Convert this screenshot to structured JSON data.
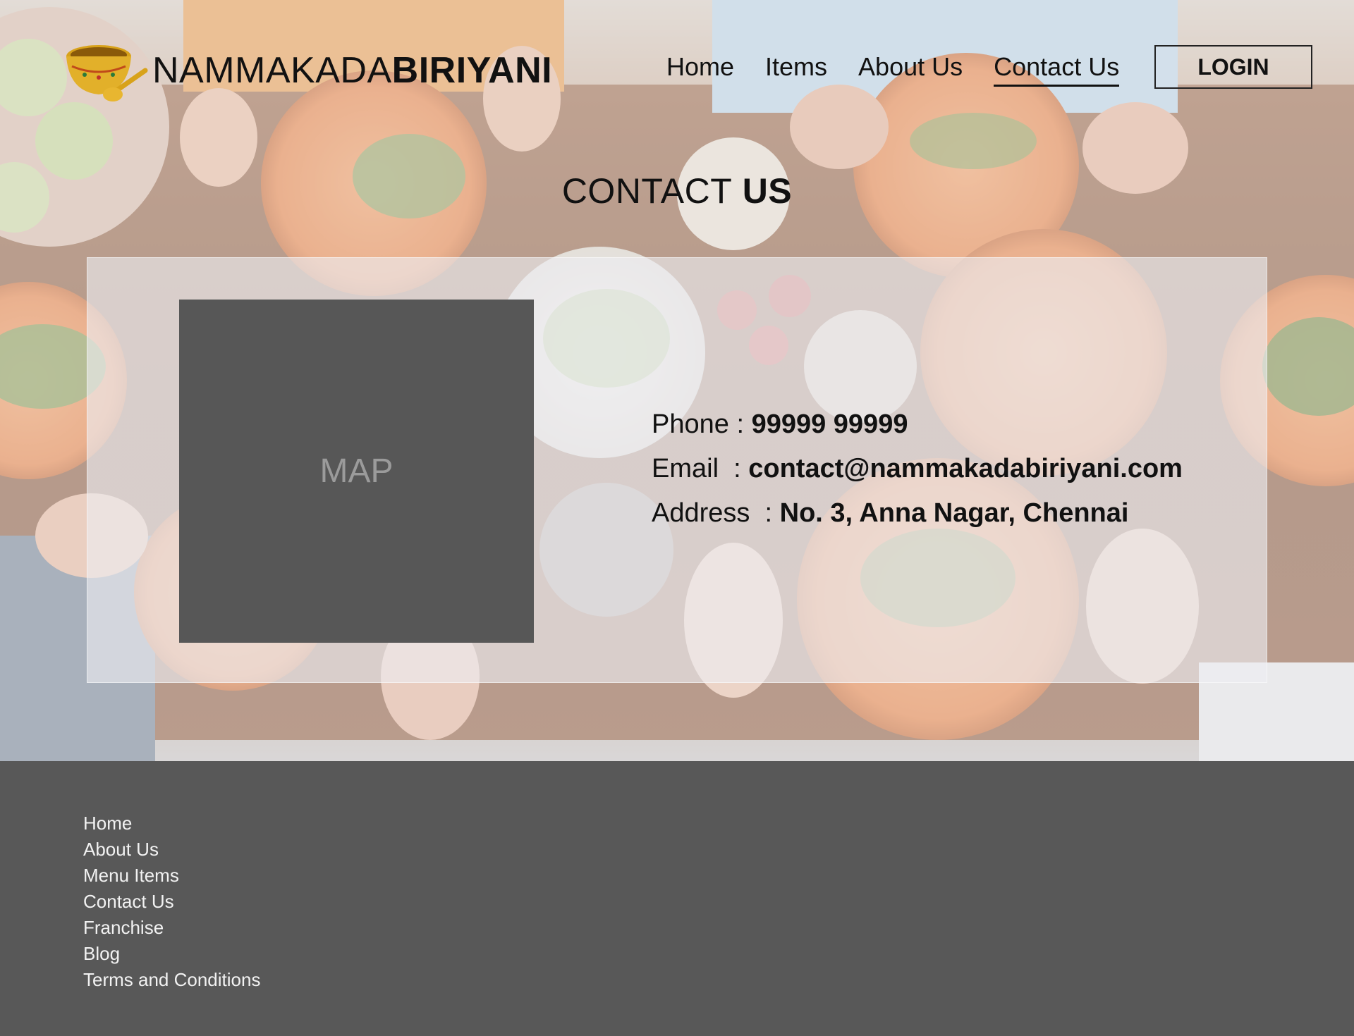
{
  "brand": {
    "name_light": "NAMMAKADA",
    "name_bold": "BIRIYANI",
    "logo_icon": "golden-bowl-with-spoon-icon"
  },
  "nav": {
    "links": [
      {
        "label": "Home",
        "active": false
      },
      {
        "label": "Items",
        "active": false
      },
      {
        "label": "About Us",
        "active": false
      },
      {
        "label": "Contact Us",
        "active": true
      }
    ],
    "login_label": "LOGIN"
  },
  "page_title": {
    "light": "CONTACT",
    "bold": "US"
  },
  "contact": {
    "map_placeholder": "MAP",
    "phone_label": "Phone : ",
    "phone_value": "99999 99999",
    "email_label": "Email  : ",
    "email_value": "contact@nammakadabiriyani.com",
    "address_label": "Address  : ",
    "address_value": "No. 3, Anna Nagar, Chennai"
  },
  "footer": {
    "links": [
      "Home",
      "About Us",
      "Menu Items",
      "Contact Us",
      "Franchise",
      "Blog",
      "Terms and Conditions"
    ]
  },
  "colors": {
    "footer_bg": "#585858",
    "map_bg": "#575757",
    "text": "#111111",
    "footer_text": "#f2f2f2"
  }
}
